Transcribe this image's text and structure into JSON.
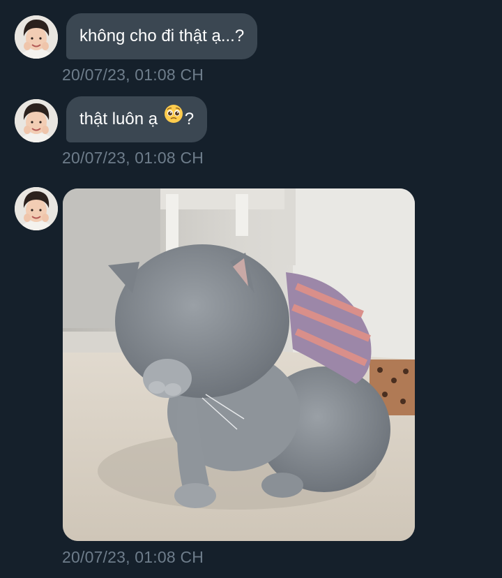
{
  "messages": [
    {
      "type": "text",
      "text": "không cho đi thật ạ...?",
      "timestamp": "20/07/23, 01:08 CH"
    },
    {
      "type": "text",
      "text_before_emoji": "thật luôn ạ",
      "emoji": "pleading-face-emoji",
      "text_after_emoji": "?",
      "timestamp": "20/07/23, 01:08 CH"
    },
    {
      "type": "image",
      "image_subject": "grey-cat-covering-face-photo",
      "timestamp": "20/07/23, 01:08 CH"
    }
  ],
  "colors": {
    "background": "#15202b",
    "bubble": "#3b4752",
    "bubble_text": "#ffffff",
    "timestamp": "#6e7d8b"
  }
}
